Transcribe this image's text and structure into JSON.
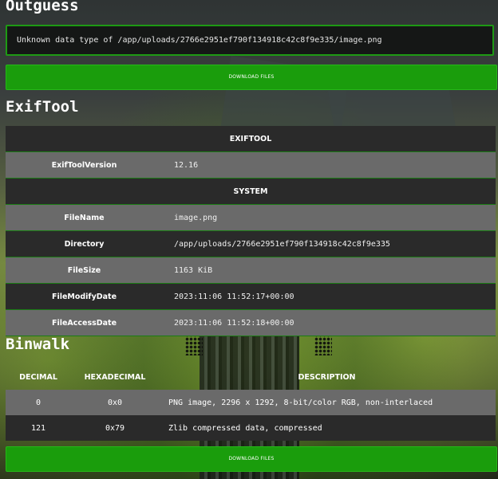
{
  "outguess": {
    "title": "Outguess",
    "message": "Unknown data type of /app/uploads/2766e2951ef790f134918c42c8f9e335/image.png",
    "download_label": "DOWNLOAD FILES"
  },
  "exiftool": {
    "title": "ExifTool",
    "groups": [
      {
        "name": "EXIFTOOL",
        "rows": [
          {
            "key": "ExifToolVersion",
            "value": "12.16"
          }
        ]
      },
      {
        "name": "SYSTEM",
        "rows": [
          {
            "key": "FileName",
            "value": "image.png"
          },
          {
            "key": "Directory",
            "value": "/app/uploads/2766e2951ef790f134918c42c8f9e335"
          },
          {
            "key": "FileSize",
            "value": "1163 KiB"
          },
          {
            "key": "FileModifyDate",
            "value": "2023:11:06 11:52:17+00:00"
          },
          {
            "key": "FileAccessDate",
            "value": "2023:11:06 11:52:18+00:00"
          }
        ]
      }
    ]
  },
  "binwalk": {
    "title": "Binwalk",
    "headers": [
      "DECIMAL",
      "HEXADECIMAL",
      "DESCRIPTION"
    ],
    "rows": [
      [
        "0",
        "0x0",
        "PNG image, 2296 x 1292, 8-bit/color RGB, non-interlaced"
      ],
      [
        "121",
        "0x79",
        "Zlib compressed data, compressed"
      ]
    ],
    "download_label": "DOWNLOAD FILES"
  },
  "colors": {
    "accent": "#1a9d0c",
    "row_light": "#6a6a6a",
    "row_dark": "#2a2a2a"
  }
}
